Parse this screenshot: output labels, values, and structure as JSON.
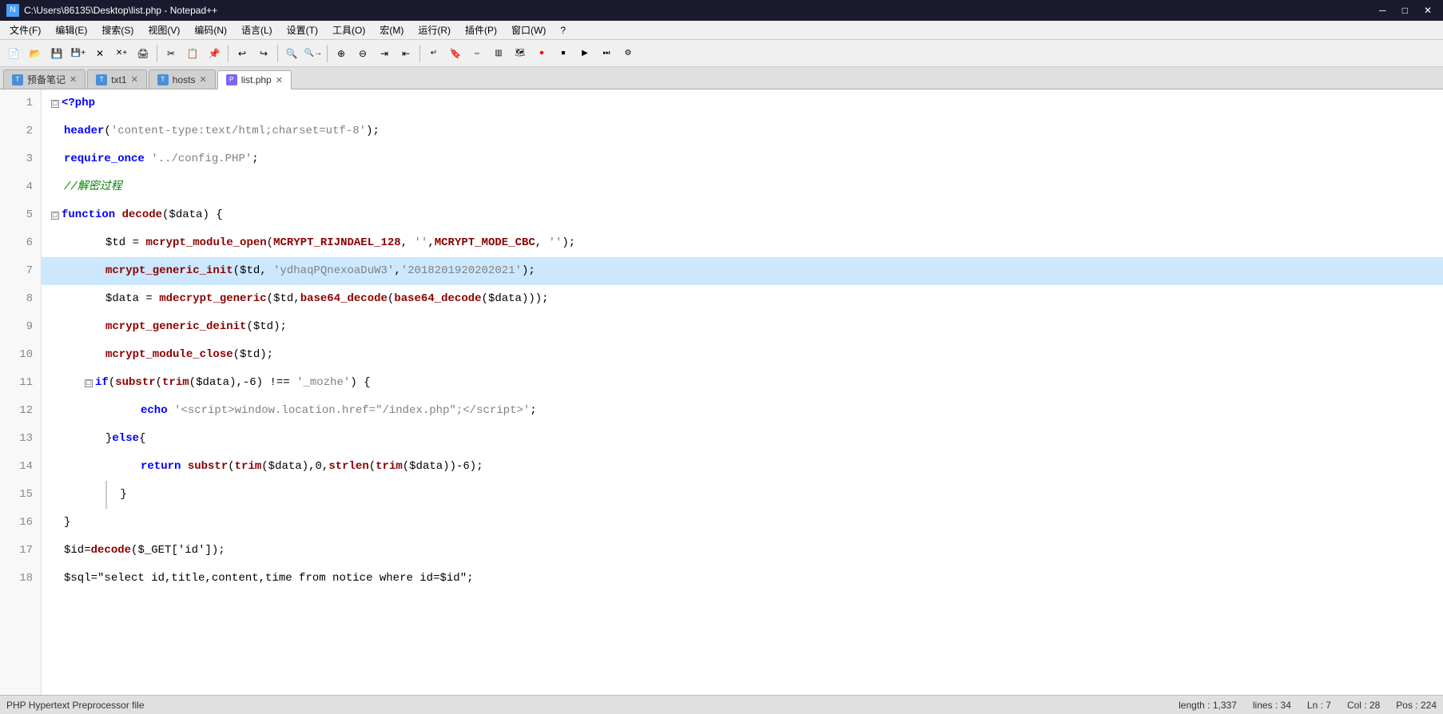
{
  "titleBar": {
    "icon": "N++",
    "title": "C:\\Users\\86135\\Desktop\\list.php - Notepad++"
  },
  "menuBar": {
    "items": [
      "文件(F)",
      "编辑(E)",
      "搜索(S)",
      "视图(V)",
      "编码(N)",
      "语言(L)",
      "设置(T)",
      "工具(O)",
      "宏(M)",
      "运行(R)",
      "插件(P)",
      "窗口(W)",
      "?"
    ]
  },
  "tabs": [
    {
      "label": "预备笔记",
      "active": false,
      "icon": "txt"
    },
    {
      "label": "txt1",
      "active": false,
      "icon": "txt"
    },
    {
      "label": "hosts",
      "active": false,
      "icon": "txt"
    },
    {
      "label": "list.php",
      "active": true,
      "icon": "php"
    }
  ],
  "lines": [
    {
      "num": 1,
      "fold": false,
      "highlight": false,
      "content_key": "line1"
    },
    {
      "num": 2,
      "fold": false,
      "highlight": false,
      "content_key": "line2"
    },
    {
      "num": 3,
      "fold": false,
      "highlight": false,
      "content_key": "line3"
    },
    {
      "num": 4,
      "fold": false,
      "highlight": false,
      "content_key": "line4"
    },
    {
      "num": 5,
      "fold": true,
      "highlight": false,
      "content_key": "line5"
    },
    {
      "num": 6,
      "fold": false,
      "highlight": false,
      "content_key": "line6"
    },
    {
      "num": 7,
      "fold": false,
      "highlight": true,
      "content_key": "line7"
    },
    {
      "num": 8,
      "fold": false,
      "highlight": false,
      "content_key": "line8"
    },
    {
      "num": 9,
      "fold": false,
      "highlight": false,
      "content_key": "line9"
    },
    {
      "num": 10,
      "fold": false,
      "highlight": false,
      "content_key": "line10"
    },
    {
      "num": 11,
      "fold": true,
      "highlight": false,
      "content_key": "line11"
    },
    {
      "num": 12,
      "fold": false,
      "highlight": false,
      "content_key": "line12"
    },
    {
      "num": 13,
      "fold": false,
      "highlight": false,
      "content_key": "line13"
    },
    {
      "num": 14,
      "fold": false,
      "highlight": false,
      "content_key": "line14"
    },
    {
      "num": 15,
      "fold": false,
      "highlight": false,
      "content_key": "line15"
    },
    {
      "num": 16,
      "fold": false,
      "highlight": false,
      "content_key": "line16"
    },
    {
      "num": 17,
      "fold": false,
      "highlight": false,
      "content_key": "line17"
    },
    {
      "num": 18,
      "fold": false,
      "highlight": false,
      "content_key": "line18"
    }
  ],
  "statusBar": {
    "fileType": "PHP Hypertext Preprocessor file",
    "length": "length : 1,337",
    "lines": "lines : 34",
    "ln": "Ln : 7",
    "col": "Col : 28",
    "pos": "Pos : 224"
  }
}
